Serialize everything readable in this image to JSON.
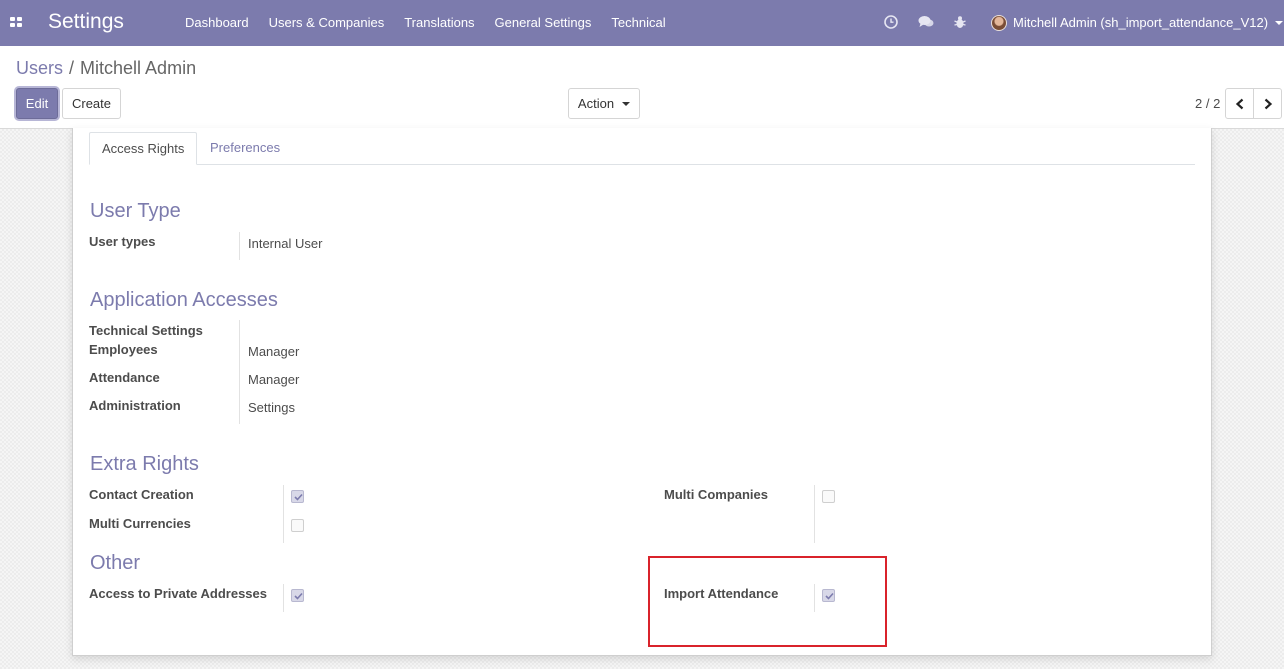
{
  "navbar": {
    "brand": "Settings",
    "menu": [
      "Dashboard",
      "Users & Companies",
      "Translations",
      "General Settings",
      "Technical"
    ],
    "user": "Mitchell Admin (sh_import_attendance_V12)",
    "icons": [
      "apps-grid-icon",
      "clock-icon",
      "chat-icon",
      "bug-icon"
    ]
  },
  "breadcrumb": {
    "parent": "Users",
    "separator": "/",
    "current": "Mitchell Admin"
  },
  "buttons": {
    "edit": "Edit",
    "create": "Create",
    "action": "Action"
  },
  "pager": {
    "value": "2 / 2"
  },
  "tabs": [
    "Access Rights",
    "Preferences"
  ],
  "user_type": {
    "title": "User Type",
    "label": "User types",
    "value": "Internal User"
  },
  "app_accesses": {
    "title": "Application Accesses",
    "rows": [
      {
        "label": "Technical Settings",
        "value": ""
      },
      {
        "label": "Employees",
        "value": "Manager"
      },
      {
        "label": "Attendance",
        "value": "Manager"
      },
      {
        "label": "Administration",
        "value": "Settings"
      }
    ]
  },
  "extra_rights": {
    "title": "Extra Rights",
    "contact_creation": {
      "label": "Contact Creation",
      "checked": true
    },
    "multi_currencies": {
      "label": "Multi Currencies",
      "checked": false
    },
    "multi_companies": {
      "label": "Multi Companies",
      "checked": false
    }
  },
  "other": {
    "title": "Other",
    "private_addresses": {
      "label": "Access to Private Addresses",
      "checked": true
    },
    "import_attendance": {
      "label": "Import Attendance",
      "checked": true
    }
  },
  "colors": {
    "brand": "#7c7bad",
    "highlight": "#d9232b"
  }
}
